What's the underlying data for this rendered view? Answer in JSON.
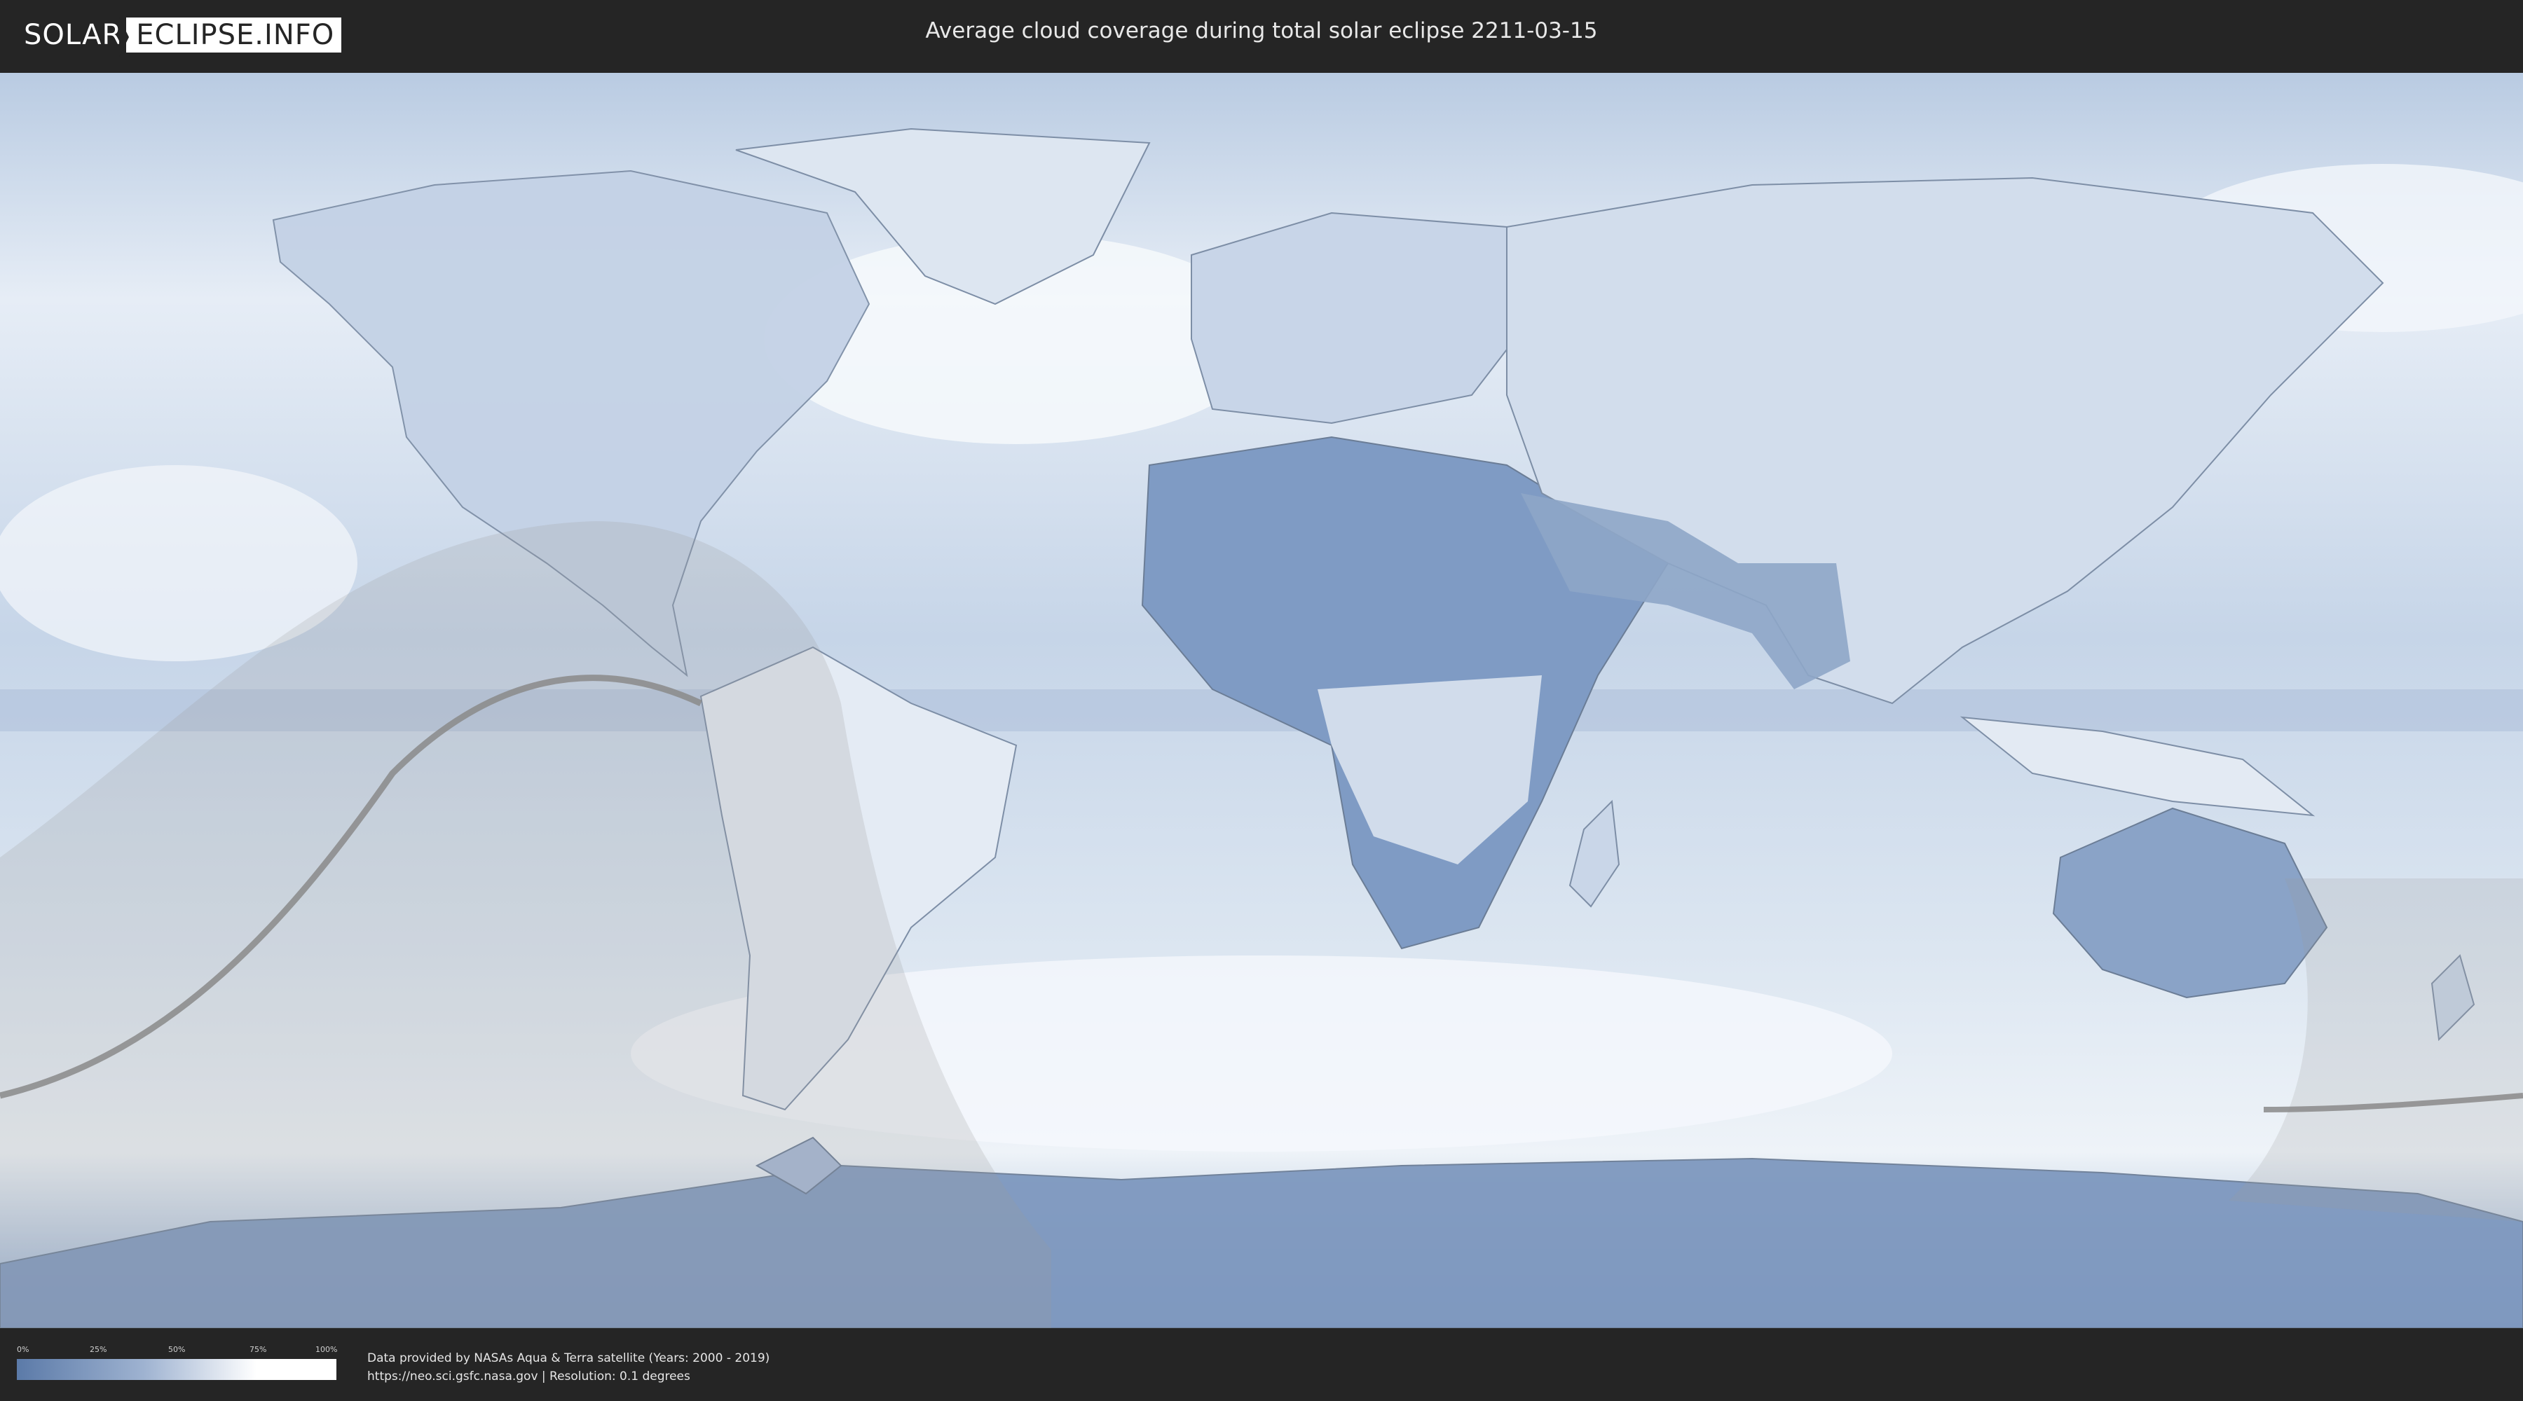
{
  "header": {
    "logo_left": "SOLAR",
    "logo_right": "ECLIPSE.INFO",
    "title": "Average cloud coverage during total solar eclipse 2211-03-15"
  },
  "map": {
    "ocean_color": "#ccd9ea",
    "land_color": "#8ea6c8",
    "cloud_color": "#f4f7fb",
    "shadow_color": "#9a9a9a"
  },
  "footer": {
    "legend": {
      "ticks": [
        "0%",
        "25%",
        "50%",
        "75%",
        "100%"
      ]
    },
    "credits_line1": "Data provided by NASAs Aqua & Terra satellite (Years: 2000 - 2019)",
    "credits_line2": "https://neo.sci.gsfc.nasa.gov | Resolution: 0.1 degrees"
  }
}
